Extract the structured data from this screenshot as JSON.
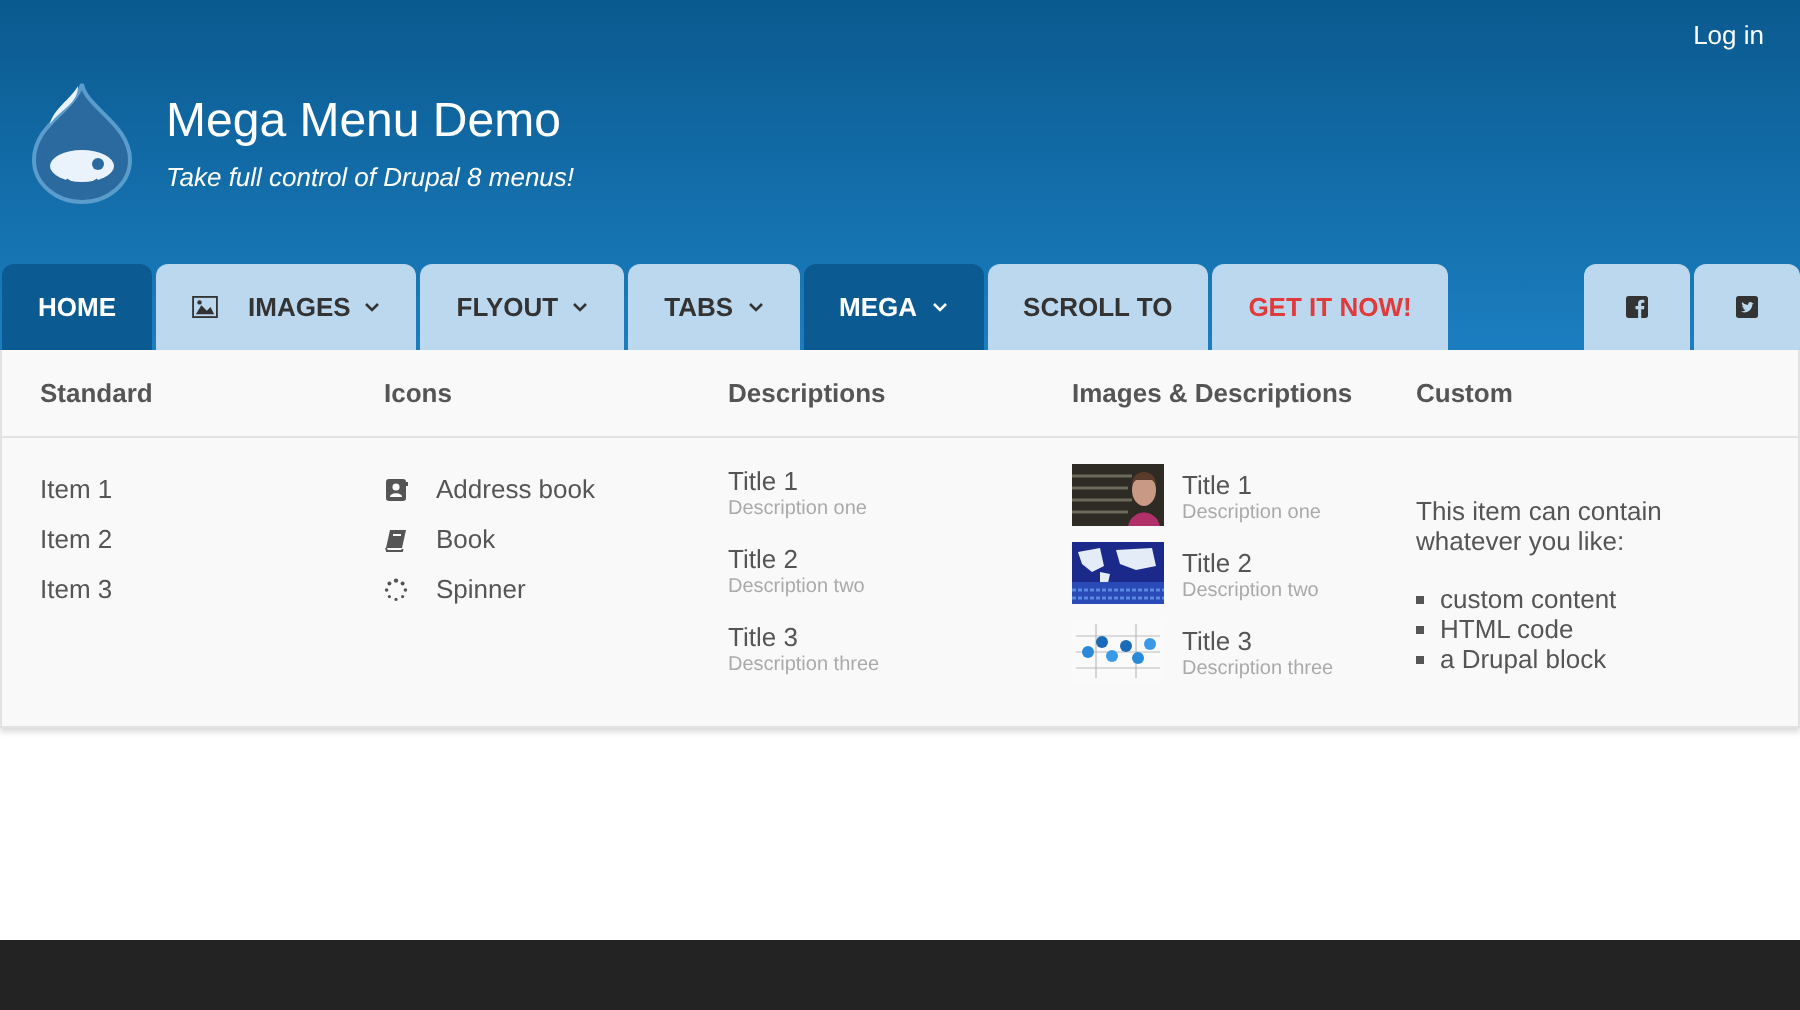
{
  "top_bar": {
    "login_link": "Log in"
  },
  "site": {
    "title": "Mega Menu Demo",
    "slogan": "Take full control of Drupal 8 menus!"
  },
  "nav": {
    "tabs": [
      {
        "label": "HOME",
        "kind": "plain",
        "selected": true,
        "has_dropdown": false
      },
      {
        "label": "IMAGES",
        "kind": "icon",
        "selected": false,
        "has_dropdown": true
      },
      {
        "label": "FLYOUT",
        "kind": "plain",
        "selected": false,
        "has_dropdown": true
      },
      {
        "label": "TABS",
        "kind": "plain",
        "selected": false,
        "has_dropdown": true
      },
      {
        "label": "MEGA",
        "kind": "plain",
        "selected": true,
        "has_dropdown": true
      },
      {
        "label": "SCROLL TO",
        "kind": "plain",
        "selected": false,
        "has_dropdown": false
      },
      {
        "label": "GET IT NOW!",
        "kind": "promo",
        "selected": false,
        "has_dropdown": false
      }
    ],
    "social": [
      {
        "kind": "facebook"
      },
      {
        "kind": "twitter"
      }
    ]
  },
  "mega_menu": {
    "columns": [
      {
        "heading": "Standard",
        "kind": "links",
        "items": [
          {
            "label": "Item 1"
          },
          {
            "label": "Item 2"
          },
          {
            "label": "Item 3"
          }
        ]
      },
      {
        "heading": "Icons",
        "kind": "icons",
        "items": [
          {
            "label": "Address book",
            "kind": "address-book"
          },
          {
            "label": "Book",
            "kind": "book"
          },
          {
            "label": "Spinner",
            "kind": "spinner"
          }
        ]
      },
      {
        "heading": "Descriptions",
        "kind": "descriptions",
        "items": [
          {
            "title": "Title 1",
            "description": "Description one"
          },
          {
            "title": "Title 2",
            "description": "Description two"
          },
          {
            "title": "Title 3",
            "description": "Description three"
          }
        ]
      },
      {
        "heading": "Images & Descriptions",
        "kind": "images",
        "items": [
          {
            "title": "Title 1",
            "description": "Description one",
            "kind": "picture"
          },
          {
            "title": "Title 2",
            "description": "Description two",
            "kind": "picture"
          },
          {
            "title": "Title 3",
            "description": "Description three",
            "kind": "picture"
          }
        ]
      },
      {
        "heading": "Custom",
        "kind": "custom",
        "text": "This item can contain whatever you like:",
        "bullets": [
          "custom content",
          "HTML code",
          "a Drupal block"
        ]
      }
    ]
  }
}
